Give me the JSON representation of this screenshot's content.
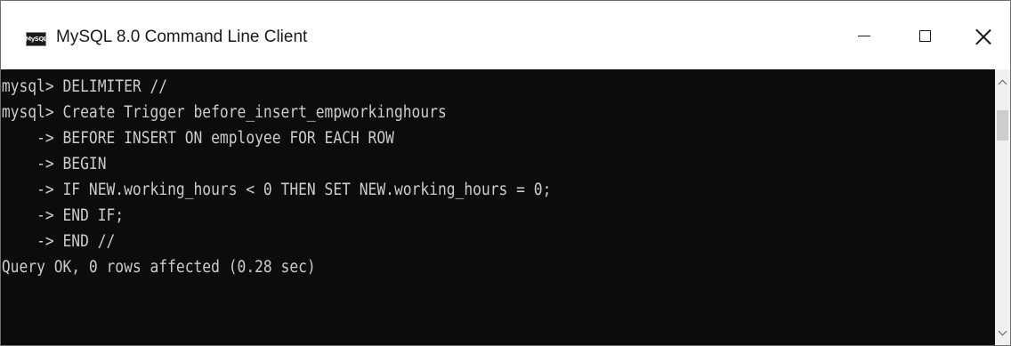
{
  "window": {
    "title": "MySQL 8.0 Command Line Client",
    "icon_label": "MySQL",
    "icon_name": "mysql-console-icon"
  },
  "titlebar_buttons": {
    "minimize": "minimize-icon",
    "maximize": "maximize-icon",
    "close": "close-icon"
  },
  "console": {
    "lines": [
      "mysql> DELIMITER //",
      "mysql> Create Trigger before_insert_empworkinghours",
      "    -> BEFORE INSERT ON employee FOR EACH ROW",
      "    -> BEGIN",
      "    -> IF NEW.working_hours < 0 THEN SET NEW.working_hours = 0;",
      "    -> END IF;",
      "    -> END //",
      "Query OK, 0 rows affected (0.28 sec)"
    ],
    "text_color": "#cccccc",
    "background_color": "#0c0c0c"
  }
}
